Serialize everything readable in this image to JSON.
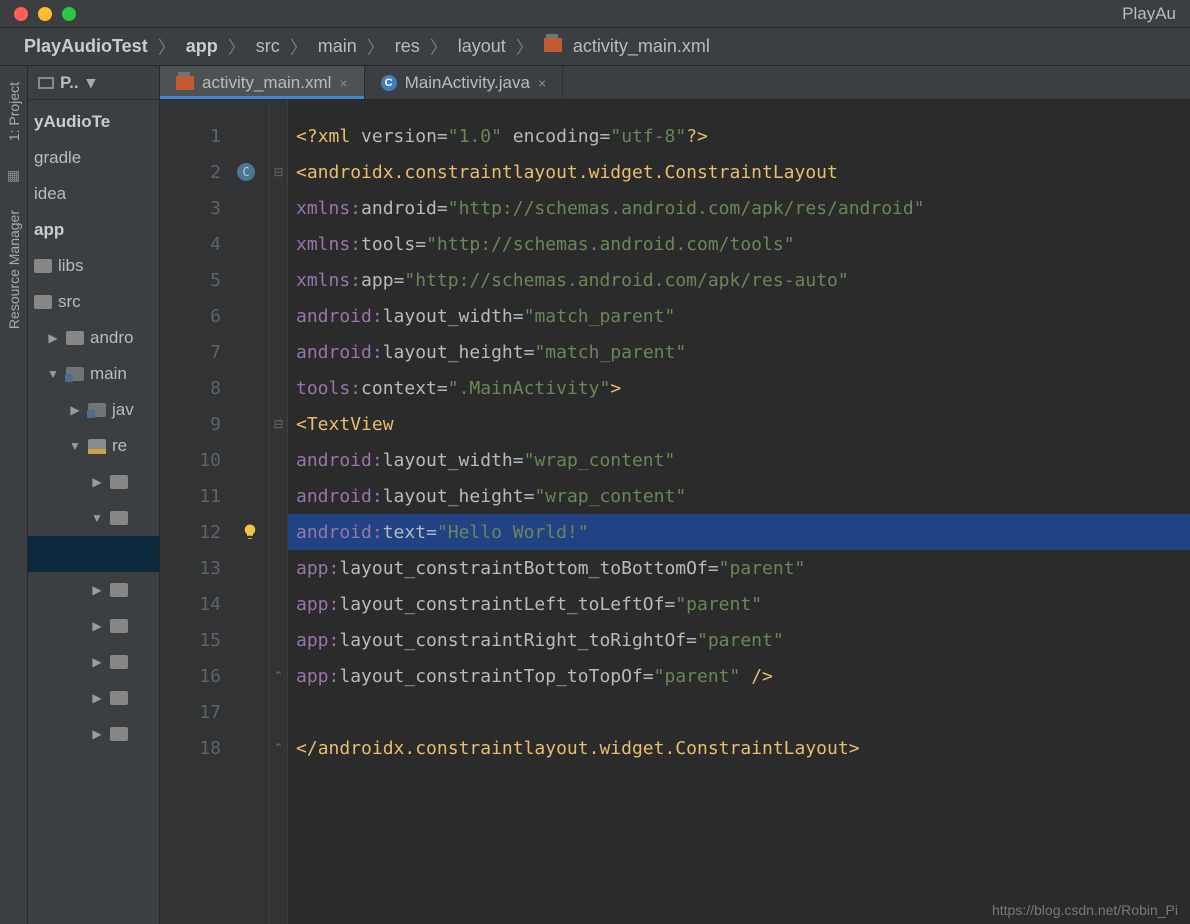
{
  "window": {
    "title": "PlayAu"
  },
  "breadcrumb": [
    {
      "label": "PlayAudioTest",
      "bold": true
    },
    {
      "label": "app",
      "bold": true
    },
    {
      "label": "src"
    },
    {
      "label": "main"
    },
    {
      "label": "res"
    },
    {
      "label": "layout"
    },
    {
      "label": "activity_main.xml",
      "icon": "xml"
    }
  ],
  "rails": {
    "project": "1: Project",
    "resmgr": "Resource Manager"
  },
  "projectPanel": {
    "header": "P..",
    "items": [
      {
        "label": "yAudioTe",
        "bold": true
      },
      {
        "label": "gradle"
      },
      {
        "label": "idea"
      },
      {
        "label": "app",
        "bold": true
      },
      {
        "label": "libs"
      },
      {
        "label": "src"
      },
      {
        "label": "andro"
      },
      {
        "label": "main"
      },
      {
        "label": "jav"
      },
      {
        "label": "re"
      }
    ]
  },
  "tabs": [
    {
      "label": "activity_main.xml",
      "icon": "xml",
      "active": true
    },
    {
      "label": "MainActivity.java",
      "icon": "java",
      "active": false
    }
  ],
  "lineNumbers": [
    "1",
    "2",
    "3",
    "4",
    "5",
    "6",
    "7",
    "8",
    "9",
    "10",
    "11",
    "12",
    "13",
    "14",
    "15",
    "16",
    "17",
    "18"
  ],
  "codeFile": {
    "rootTag": "androidx.constraintlayout.widget.ConstraintLayout",
    "xmlDecl": {
      "version": "1.0",
      "encoding": "utf-8"
    },
    "rootAttrs": {
      "xmlns:android": "http://schemas.android.com/apk/res/android",
      "xmlns:tools": "http://schemas.android.com/tools",
      "xmlns:app": "http://schemas.android.com/apk/res-auto",
      "android:layout_width": "match_parent",
      "android:layout_height": "match_parent",
      "tools:context": ".MainActivity"
    },
    "childTag": "TextView",
    "childAttrs": {
      "android:layout_width": "wrap_content",
      "android:layout_height": "wrap_content",
      "android:text": "Hello World!",
      "app:layout_constraintBottom_toBottomOf": "parent",
      "app:layout_constraintLeft_toLeftOf": "parent",
      "app:layout_constraintRight_toRightOf": "parent",
      "app:layout_constraintTop_toTopOf": "parent"
    }
  },
  "selectedLine": 12,
  "watermark": "https://blog.csdn.net/Robin_Pi"
}
